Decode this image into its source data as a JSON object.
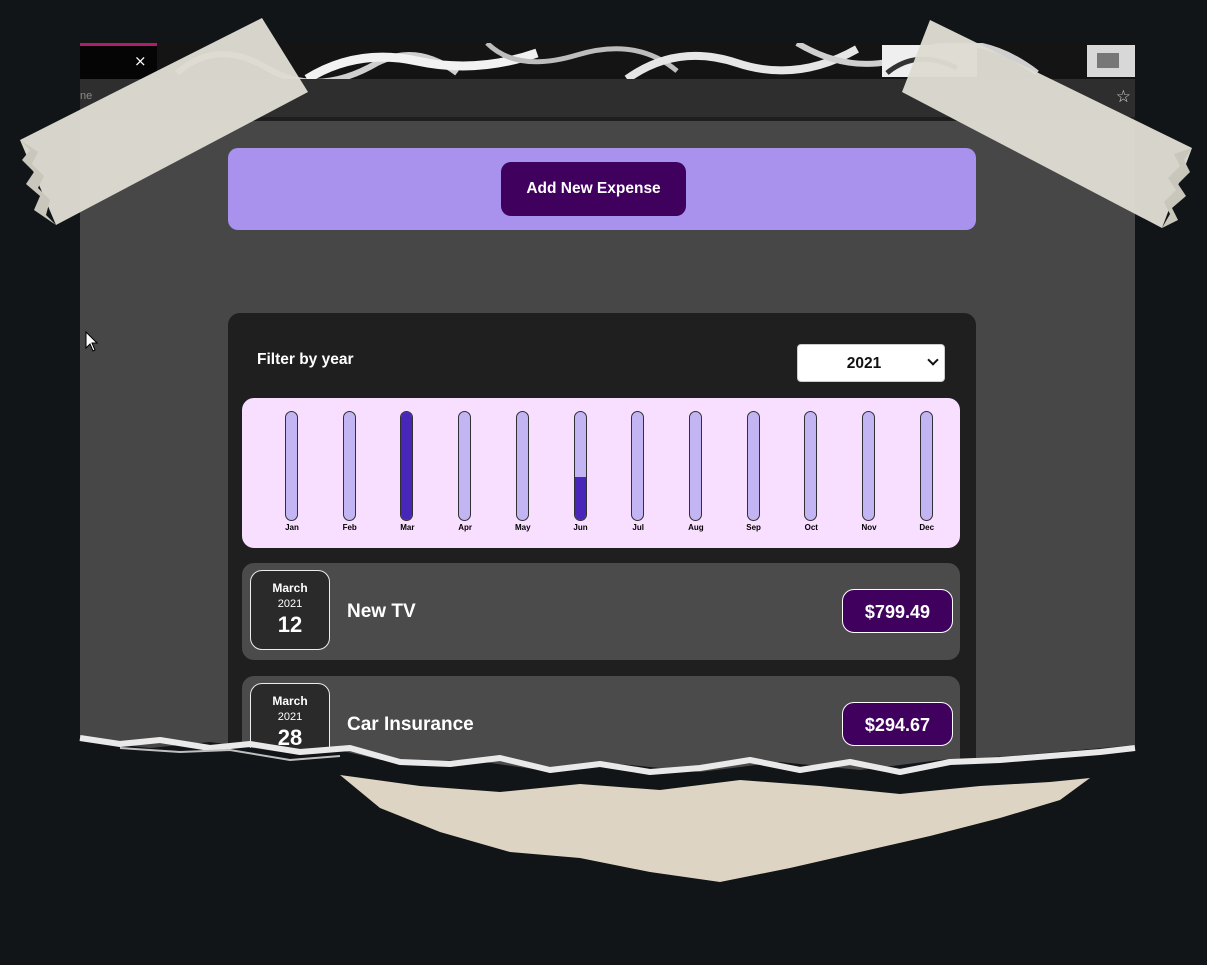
{
  "browser": {
    "tab_close": "×",
    "url_fragment": "ne",
    "bookmark_icon": "☆"
  },
  "app": {
    "add_expense_label": "Add New Expense",
    "filter_label": "Filter by year",
    "selected_year": "2021",
    "colors": {
      "banner": "#a892ee",
      "button": "#40005d",
      "chart_bg": "#f8dfff",
      "bar_track": "#c3b4f3",
      "bar_fill": "#4826b9"
    }
  },
  "chart_data": {
    "type": "bar",
    "categories": [
      "Jan",
      "Feb",
      "Mar",
      "Apr",
      "May",
      "Jun",
      "Jul",
      "Aug",
      "Sep",
      "Oct",
      "Nov",
      "Dec"
    ],
    "values": [
      0,
      0,
      1.0,
      0,
      0,
      0.4,
      0,
      0,
      0,
      0,
      0,
      0
    ],
    "ylim": [
      0,
      1
    ]
  },
  "expenses": [
    {
      "month": "March",
      "year": "2021",
      "day": "12",
      "title": "New TV",
      "amount": "$799.49"
    },
    {
      "month": "March",
      "year": "2021",
      "day": "28",
      "title": "Car Insurance",
      "amount": "$294.67"
    }
  ]
}
